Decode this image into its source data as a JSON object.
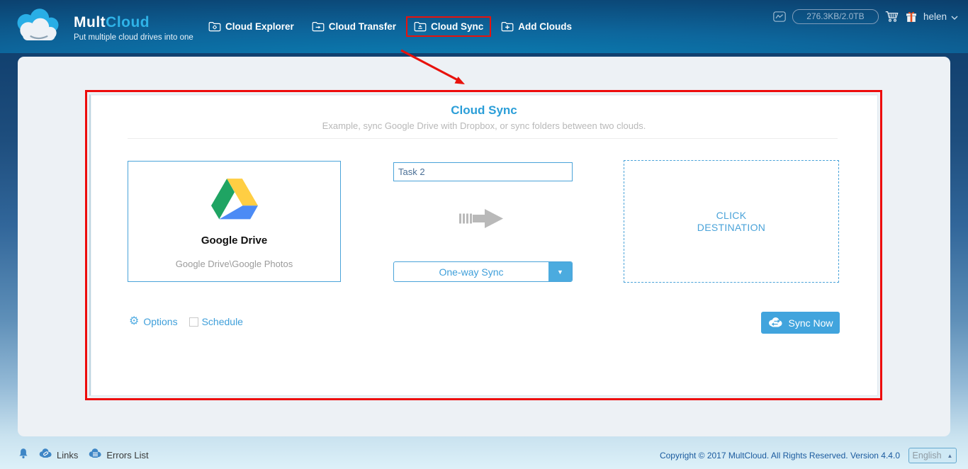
{
  "header": {
    "brand_mult": "Mult",
    "brand_cloud": "Cloud",
    "tagline": "Put multiple cloud drives into one",
    "nav": [
      {
        "label": "Cloud Explorer"
      },
      {
        "label": "Cloud Transfer"
      },
      {
        "label": "Cloud Sync"
      },
      {
        "label": "Add Clouds"
      }
    ],
    "storage": "276.3KB/2.0TB",
    "username": "helen"
  },
  "panel": {
    "title": "Cloud Sync",
    "subtitle": "Example, sync Google Drive with Dropbox, or sync folders between two clouds.",
    "source": {
      "name": "Google Drive",
      "path": "Google Drive\\Google Photos"
    },
    "task_name": "Task 2",
    "sync_mode": "One-way Sync",
    "destination_label": "CLICK DESTINATION",
    "options_label": "Options",
    "schedule_label": "Schedule",
    "sync_now_label": "Sync Now"
  },
  "footer": {
    "links_label": "Links",
    "errors_label": "Errors List",
    "copyright": "Copyright © 2017 MultCloud. All Rights Reserved. Version 4.4.0",
    "language": "English"
  },
  "colors": {
    "accent_blue": "#41a4dd",
    "highlight_red": "#e8120c",
    "drive_green": "#1fa463",
    "drive_yellow": "#ffce43",
    "drive_blue": "#4c8bf5"
  }
}
